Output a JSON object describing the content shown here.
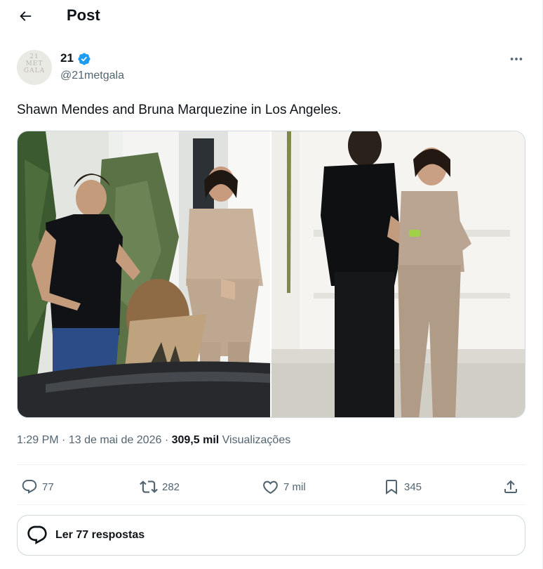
{
  "header": {
    "title": "Post"
  },
  "author": {
    "name": "21",
    "handle": "@21metgala",
    "avatar_text": "21\nMET\nGALA",
    "verified": true
  },
  "tweet": {
    "text": "Shawn Mendes and Bruna Marquezine in Los Angeles."
  },
  "meta": {
    "time": "1:29 PM",
    "separator": "·",
    "date": "13 de mai de 2026",
    "views_count": "309,5 mil",
    "views_label": "Visualizações"
  },
  "actions": {
    "replies": "77",
    "reposts": "282",
    "likes": "7 mil",
    "bookmarks": "345"
  },
  "replies_button": {
    "label": "Ler 77 respostas"
  },
  "colors": {
    "text_primary": "#0f1419",
    "text_secondary": "#536471",
    "verified_blue": "#1d9bf0",
    "border": "#cfd9de",
    "divider": "#eff3f4"
  },
  "icons": {
    "back": "arrow-left-icon",
    "verified": "verified-badge-icon",
    "more": "ellipsis-icon",
    "reply": "speech-bubble-icon",
    "repost": "repost-arrows-icon",
    "like": "heart-icon",
    "bookmark": "bookmark-icon",
    "share": "share-upload-icon",
    "replies": "speech-bubble-icon"
  }
}
